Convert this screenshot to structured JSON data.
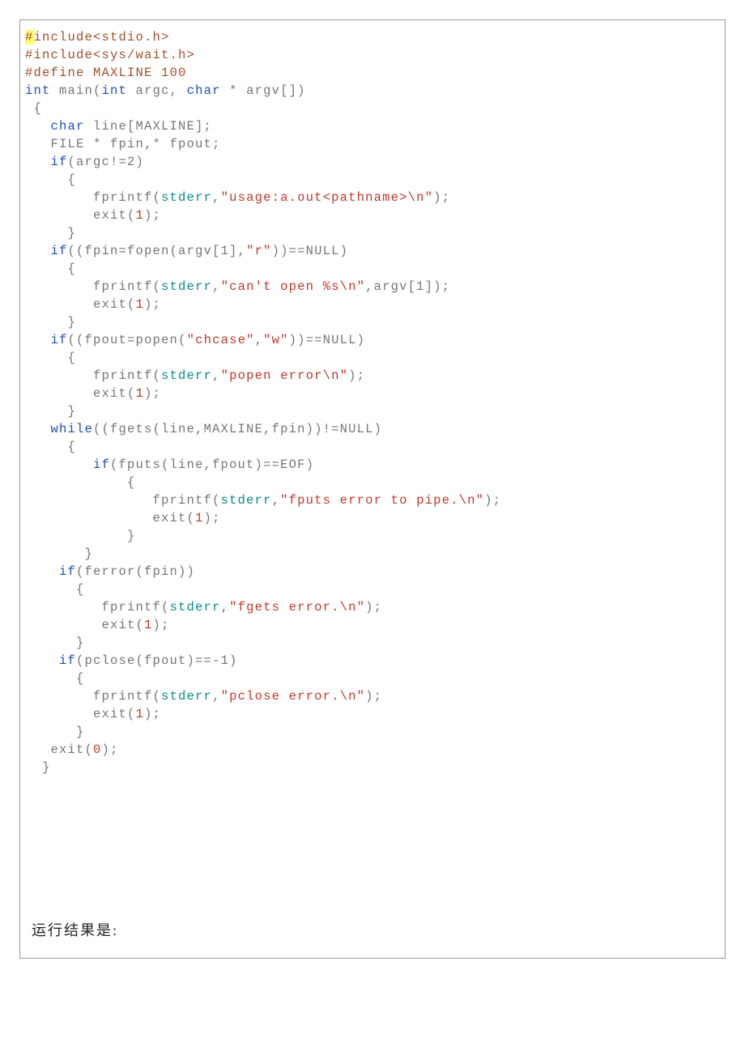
{
  "code": {
    "line01a": "#",
    "line01b": "include<stdio.h>",
    "line02": "#include<sys/wait.h>",
    "line03": "#define MAXLINE 100",
    "line04_a": "int",
    "line04_b": " main(",
    "line04_c": "int",
    "line04_d": " argc, ",
    "line04_e": "char",
    "line04_f": " * argv[])",
    "line05": " {",
    "line06_a": "   ",
    "line06_b": "char",
    "line06_c": " line[MAXLINE];",
    "line07_a": "   FILE * fpin,* fpout;",
    "line08_a": "   ",
    "line08_b": "if",
    "line08_c": "(argc!=2)",
    "line09": "     {",
    "line10_a": "        fprintf(",
    "line10_b": "stderr",
    "line10_c": ",",
    "line10_d": "\"usage:a.out<pathname>\\n\"",
    "line10_e": ");",
    "line11_a": "        exit(",
    "line11_b": "1",
    "line11_c": ");",
    "line12": "     }",
    "line13_a": "   ",
    "line13_b": "if",
    "line13_c": "((fpin=fopen(argv[1],",
    "line13_d": "\"r\"",
    "line13_e": "))==NULL)",
    "line14": "     {",
    "line15_a": "        fprintf(",
    "line15_b": "stderr",
    "line15_c": ",",
    "line15_d": "\"can't open %s\\n\"",
    "line15_e": ",argv[1]);",
    "line16_a": "        exit(",
    "line16_b": "1",
    "line16_c": ");",
    "line17": "     }",
    "line18_a": "   ",
    "line18_b": "if",
    "line18_c": "((fpout=popen(",
    "line18_d": "\"chcase\"",
    "line18_e": ",",
    "line18_f": "\"w\"",
    "line18_g": "))==NULL)",
    "line19": "     {",
    "line20_a": "        fprintf(",
    "line20_b": "stderr",
    "line20_c": ",",
    "line20_d": "\"popen error\\n\"",
    "line20_e": ");",
    "line21_a": "        exit(",
    "line21_b": "1",
    "line21_c": ");",
    "line22": "     }",
    "line23_a": "   ",
    "line23_b": "while",
    "line23_c": "((fgets(line,MAXLINE,fpin))!=NULL)",
    "line24": "     {",
    "line25_a": "        ",
    "line25_b": "if",
    "line25_c": "(fputs(line,fpout)==EOF)",
    "line26": "            {",
    "line27_a": "               fprintf(",
    "line27_b": "stderr",
    "line27_c": ",",
    "line27_d": "\"fputs error to pipe.\\n\"",
    "line27_e": ");",
    "line28_a": "               exit(",
    "line28_b": "1",
    "line28_c": ");",
    "line29": "            }",
    "line30": "       }",
    "line31_a": "    ",
    "line31_b": "if",
    "line31_c": "(ferror(fpin))",
    "line32": "      {",
    "line33_a": "         fprintf(",
    "line33_b": "stderr",
    "line33_c": ",",
    "line33_d": "\"fgets error.\\n\"",
    "line33_e": ");",
    "line34_a": "         exit(",
    "line34_b": "1",
    "line34_c": ");",
    "line35": "      }",
    "line36_a": "    ",
    "line36_b": "if",
    "line36_c": "(pclose(fpout)==-1)",
    "line37": "      {",
    "line38_a": "        fprintf(",
    "line38_b": "stderr",
    "line38_c": ",",
    "line38_d": "\"pclose error.\\n\"",
    "line38_e": ");",
    "line39_a": "        exit(",
    "line39_b": "1",
    "line39_c": ");",
    "line40": "      }",
    "line41_a": "   exit(",
    "line41_b": "0",
    "line41_c": ");",
    "line42": "  }"
  },
  "result_label": "运行结果是:"
}
